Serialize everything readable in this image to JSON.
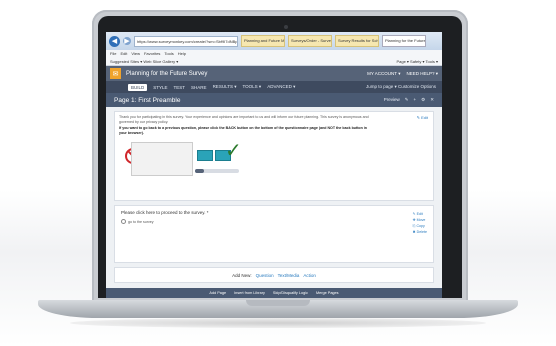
{
  "browser": {
    "address": "https://www.surveymonkey.com/create/?sm=Sbf9I7dNBp0",
    "tabs": [
      "Planning and Future Making",
      "Surveys/Order - Survey Proof",
      "Survey Results for Sch. Plan...",
      "Planning for the Future Sur..."
    ],
    "menu": [
      "File",
      "Edit",
      "View",
      "Favorites",
      "Tools",
      "Help"
    ],
    "favorites_left": "Suggested Sites ▾   Web Slice Gallery ▾",
    "favorites_right": "Page ▾  Safety ▾  Tools ▾"
  },
  "app": {
    "title": "Planning for the Future Survey",
    "account": "MY ACCOUNT ▾",
    "help": "NEED HELP? ▾",
    "nav": [
      "BUILD",
      "STYLE",
      "TEST",
      "SHARE",
      "RESULTS ▾",
      "TOOLS ▾",
      "ADVANCED ▾"
    ],
    "jump": "Jump to page ▾   Customize   Options"
  },
  "page": {
    "title": "Page 1: First Preamble",
    "tools": [
      "Preview",
      "✎",
      "+",
      "⚙",
      "✕"
    ],
    "intro_text": "Thank you for participating in this survey. Your experience and opinions are important to us and will inform our future planning. This survey is anonymous and governed by our privacy policy.",
    "intro_bold": "If you want to go back to a previous question, please click the BACK button on the bottom of the questionnaire page (and NOT the back button in your browser).",
    "edit": "✎ Edit",
    "progress_fraction": 0.2
  },
  "question": {
    "text": "Please click here to proceed to the survey. *",
    "option": "go to the survey",
    "actions": [
      "✎ Edit",
      "✥ Move",
      "⎘ Copy",
      "✖ Delete"
    ]
  },
  "add_new": {
    "label": "Add New:",
    "links": [
      "Question",
      "Text/Media",
      "Action"
    ]
  },
  "footer": [
    "Add Page",
    "Insert from Library",
    "Skip/Disqualify Logic",
    "Merge Pages"
  ]
}
